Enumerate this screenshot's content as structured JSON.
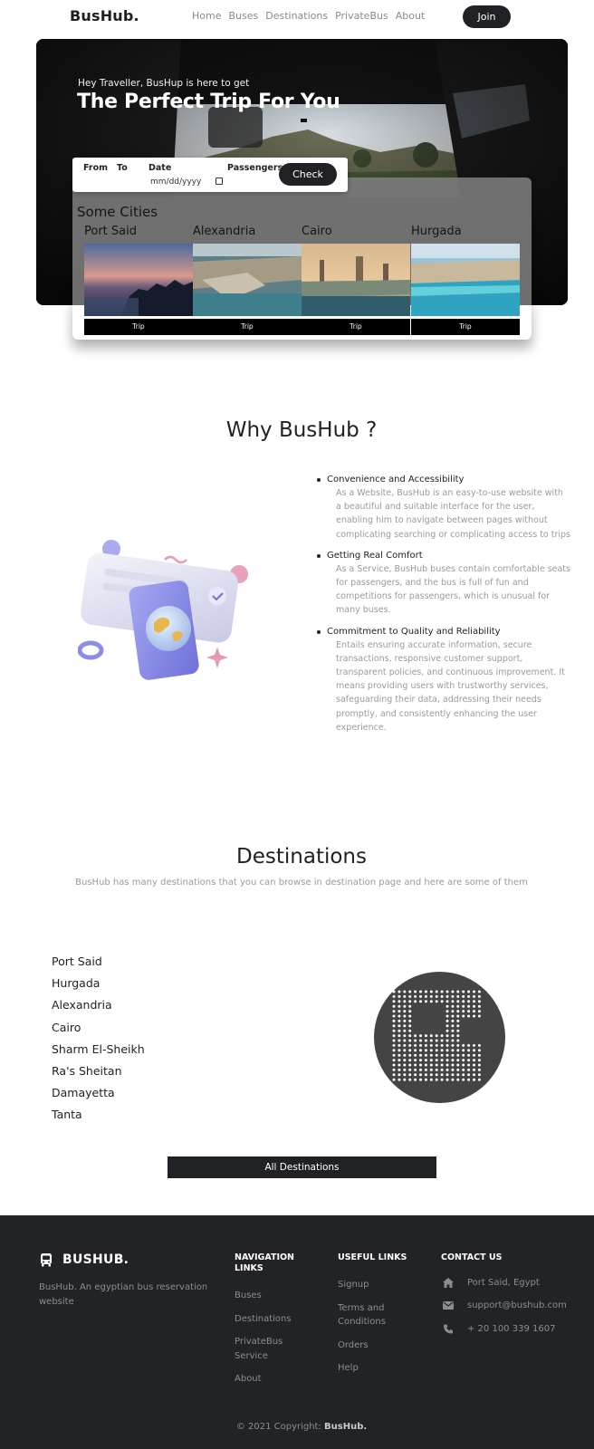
{
  "nav": {
    "logo": "BusHub.",
    "links": [
      "Home",
      "Buses",
      "Destinations",
      "PrivateBus",
      "About"
    ],
    "join_label": "Join"
  },
  "hero": {
    "subtitle": "Hey Traveller, BusHup is here to get",
    "title": "The Perfect Trip For You"
  },
  "search": {
    "from_label": "From",
    "to_label": "To",
    "date_label": "Date",
    "date_placeholder": "mm/dd/yyyy",
    "passengers_label": "Passengers",
    "check_label": "Check"
  },
  "cities": {
    "title": "Some Cities",
    "items": [
      {
        "name": "Port Said",
        "button": "Trip"
      },
      {
        "name": "Alexandria",
        "button": "Trip"
      },
      {
        "name": "Cairo",
        "button": "Trip"
      },
      {
        "name": "Hurgada",
        "button": "Trip"
      }
    ]
  },
  "why": {
    "title": "Why BusHub ?",
    "items": [
      {
        "heading": "Convenience and Accessibility",
        "text": "As a Website, BusHub is an easy-to-use website with a beautiful and suitable interface for the user, enabling him to navigate between pages without complicating searching or complicating access to trips"
      },
      {
        "heading": "Getting Real Comfort",
        "text": "As a Service, BusHub buses contain comfortable seats for passengers, and the bus is full of fun and competitions for passengers, which is unusual for many buses."
      },
      {
        "heading": "Commitment to Quality and Reliability",
        "text": "Entails ensuring accurate information, secure transactions, responsive customer support, transparent policies, and continuous improvement. It means providing users with trustworthy services, safeguarding their data, addressing their needs promptly, and consistently enhancing the user experience."
      }
    ]
  },
  "destinations": {
    "title": "Destinations",
    "subtitle": "BusHub has many destinations that you can browse in destination page and here are some of them",
    "list": [
      "Port Said",
      "Hurgada",
      "Alexandria",
      "Cairo",
      "Sharm El-Sheikh",
      "Ra's Sheitan",
      "Damayetta",
      "Tanta"
    ],
    "all_button": "All Destinations"
  },
  "footer": {
    "logo": "BUSHUB.",
    "description": "BusHub. An egyptian bus reservation website",
    "nav_title_1": "NAVIGATION",
    "nav_title_2": "LINKS",
    "nav_links": [
      [
        "Buses"
      ],
      [
        "Destinations"
      ],
      [
        "PrivateBus",
        "Service"
      ],
      [
        "About"
      ]
    ],
    "useful_title": "USEFUL LINKS",
    "useful_links": [
      [
        "Signup"
      ],
      [
        "Terms and",
        "Conditions"
      ],
      [
        "Orders"
      ],
      [
        "Help"
      ]
    ],
    "contact_title": "CONTACT US",
    "contact": {
      "address": "Port Said, Egypt",
      "email": "support@bushub.com",
      "phone": "+ 20 100 339 1607"
    },
    "copyright_prefix": "© 2021 Copyright: ",
    "copyright_brand": "BusHub."
  }
}
